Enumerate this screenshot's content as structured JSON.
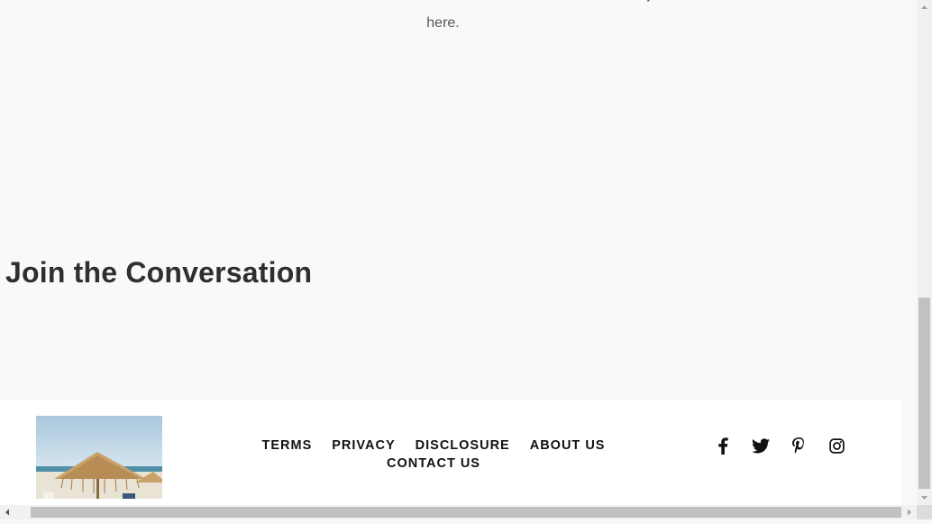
{
  "notice": {
    "line1": "You have no new offers at this time. Please check back soon. In the meantime, feel free to join one of our discussions",
    "line2": "here."
  },
  "conversation": {
    "title": "Join the Conversation"
  },
  "footer": {
    "logo_alt": "beach umbrella photo",
    "nav": [
      {
        "label": "TERMS"
      },
      {
        "label": "PRIVACY"
      },
      {
        "label": "DISCLOSURE"
      },
      {
        "label": "ABOUT US"
      },
      {
        "label": "CONTACT US"
      }
    ],
    "social": [
      {
        "icon": "facebook-icon"
      },
      {
        "icon": "twitter-icon"
      },
      {
        "icon": "pinterest-icon"
      },
      {
        "icon": "instagram-icon"
      }
    ]
  },
  "colors": {
    "page_background": "#f9f9f9",
    "footer_background": "#ffffff",
    "heading": "#2f2f2f",
    "nav_text": "#111111"
  }
}
